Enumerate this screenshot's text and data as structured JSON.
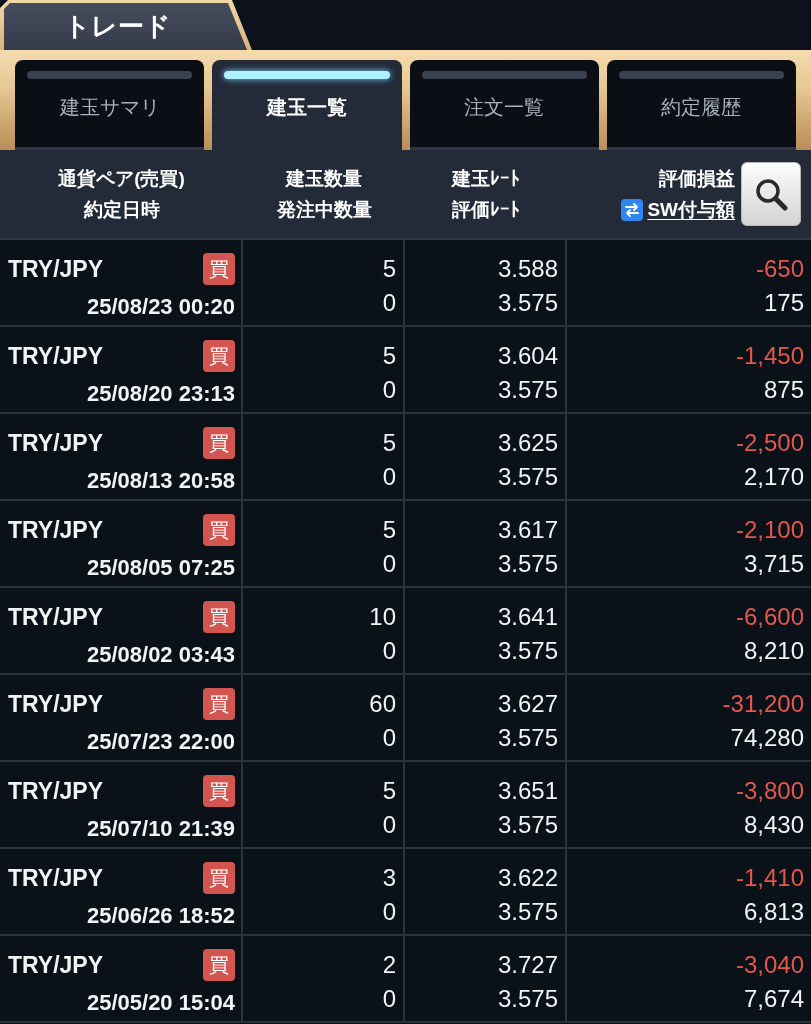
{
  "section_tab": {
    "label": "トレード"
  },
  "tabs": [
    {
      "label": "建玉サマリ",
      "selected": false
    },
    {
      "label": "建玉一覧",
      "selected": true
    },
    {
      "label": "注文一覧",
      "selected": false
    },
    {
      "label": "約定履歴",
      "selected": false
    }
  ],
  "columns": [
    {
      "title": "通貨ペア(売買)",
      "subtitle": "約定日時",
      "kind": "plain"
    },
    {
      "title": "建玉数量",
      "subtitle": "発注中数量",
      "kind": "plain"
    },
    {
      "title": "建玉ﾚｰﾄ",
      "subtitle": "評価ﾚｰﾄ",
      "kind": "plain"
    },
    {
      "title": "評価損益",
      "subtitle": "SW付与額",
      "kind": "link"
    }
  ],
  "rows": [
    {
      "pair": "TRY/JPY",
      "side": "買",
      "datetime": "25/08/23 00:20",
      "quantity": "5",
      "pending_quantity": "0",
      "entry_rate": "3.588",
      "valuation_rate": "3.575",
      "profit_loss": "-650",
      "profit_loss_negative": true,
      "swap": "175"
    },
    {
      "pair": "TRY/JPY",
      "side": "買",
      "datetime": "25/08/20 23:13",
      "quantity": "5",
      "pending_quantity": "0",
      "entry_rate": "3.604",
      "valuation_rate": "3.575",
      "profit_loss": "-1,450",
      "profit_loss_negative": true,
      "swap": "875"
    },
    {
      "pair": "TRY/JPY",
      "side": "買",
      "datetime": "25/08/13 20:58",
      "quantity": "5",
      "pending_quantity": "0",
      "entry_rate": "3.625",
      "valuation_rate": "3.575",
      "profit_loss": "-2,500",
      "profit_loss_negative": true,
      "swap": "2,170"
    },
    {
      "pair": "TRY/JPY",
      "side": "買",
      "datetime": "25/08/05 07:25",
      "quantity": "5",
      "pending_quantity": "0",
      "entry_rate": "3.617",
      "valuation_rate": "3.575",
      "profit_loss": "-2,100",
      "profit_loss_negative": true,
      "swap": "3,715"
    },
    {
      "pair": "TRY/JPY",
      "side": "買",
      "datetime": "25/08/02 03:43",
      "quantity": "10",
      "pending_quantity": "0",
      "entry_rate": "3.641",
      "valuation_rate": "3.575",
      "profit_loss": "-6,600",
      "profit_loss_negative": true,
      "swap": "8,210"
    },
    {
      "pair": "TRY/JPY",
      "side": "買",
      "datetime": "25/07/23 22:00",
      "quantity": "60",
      "pending_quantity": "0",
      "entry_rate": "3.627",
      "valuation_rate": "3.575",
      "profit_loss": "-31,200",
      "profit_loss_negative": true,
      "swap": "74,280"
    },
    {
      "pair": "TRY/JPY",
      "side": "買",
      "datetime": "25/07/10 21:39",
      "quantity": "5",
      "pending_quantity": "0",
      "entry_rate": "3.651",
      "valuation_rate": "3.575",
      "profit_loss": "-3,800",
      "profit_loss_negative": true,
      "swap": "8,430"
    },
    {
      "pair": "TRY/JPY",
      "side": "買",
      "datetime": "25/06/26 18:52",
      "quantity": "3",
      "pending_quantity": "0",
      "entry_rate": "3.622",
      "valuation_rate": "3.575",
      "profit_loss": "-1,410",
      "profit_loss_negative": true,
      "swap": "6,813"
    },
    {
      "pair": "TRY/JPY",
      "side": "買",
      "datetime": "25/05/20 15:04",
      "quantity": "2",
      "pending_quantity": "0",
      "entry_rate": "3.727",
      "valuation_rate": "3.575",
      "profit_loss": "-3,040",
      "profit_loss_negative": true,
      "swap": "7,674"
    }
  ]
}
